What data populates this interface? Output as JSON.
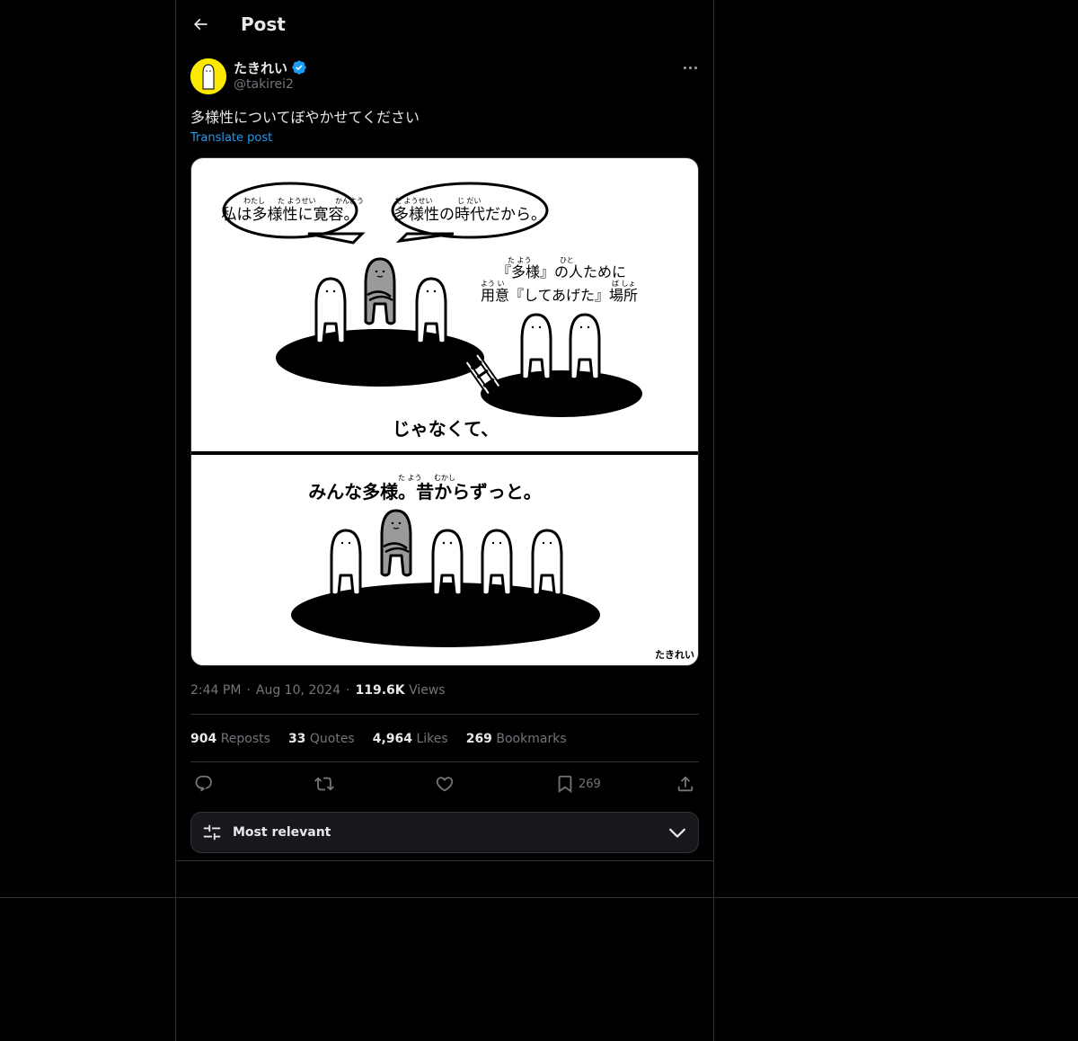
{
  "header": {
    "title": "Post"
  },
  "author": {
    "display_name": "たきれい",
    "handle": "@takirei2",
    "verified": true
  },
  "post": {
    "text": "多様性についてぼやかせてください",
    "translate_label": "Translate post",
    "image": {
      "top_panel": {
        "speech_bubble_1": "私は多様性に寛容。",
        "speech_bubble_1_ruby": [
          "わたし",
          "た ようせい",
          "かんよう"
        ],
        "speech_bubble_2": "多様性の時代だから。",
        "speech_bubble_2_ruby": [
          "た ようせい",
          "じ だい"
        ],
        "side_caption_line1": "『多様』の人ために",
        "side_caption_line1_ruby": [
          "た よう",
          "ひと"
        ],
        "side_caption_line2": "用意『してあげた』場所",
        "side_caption_line2_ruby": [
          "よう い",
          "ば しょ"
        ],
        "bottom_caption": "じゃなくて、"
      },
      "bottom_panel": {
        "caption": "みんな多様。昔からずっと。",
        "caption_ruby": [
          "た よう",
          "むかし"
        ]
      },
      "signature": "たきれい"
    }
  },
  "meta": {
    "time": "2:44 PM",
    "separator": "·",
    "date": "Aug 10, 2024",
    "views_count": "119.6K",
    "views_label": "Views"
  },
  "stats": [
    {
      "count": "904",
      "label": "Reposts"
    },
    {
      "count": "33",
      "label": "Quotes"
    },
    {
      "count": "4,964",
      "label": "Likes"
    },
    {
      "count": "269",
      "label": "Bookmarks"
    }
  ],
  "actions": {
    "bookmark_count": "269"
  },
  "sort": {
    "label": "Most relevant"
  },
  "colors": {
    "background": "#000000",
    "border": "#2f3336",
    "link": "#1d9bf0",
    "muted": "#71767b",
    "verified": "#1d9bf0",
    "avatar_bg": "#fde900"
  }
}
